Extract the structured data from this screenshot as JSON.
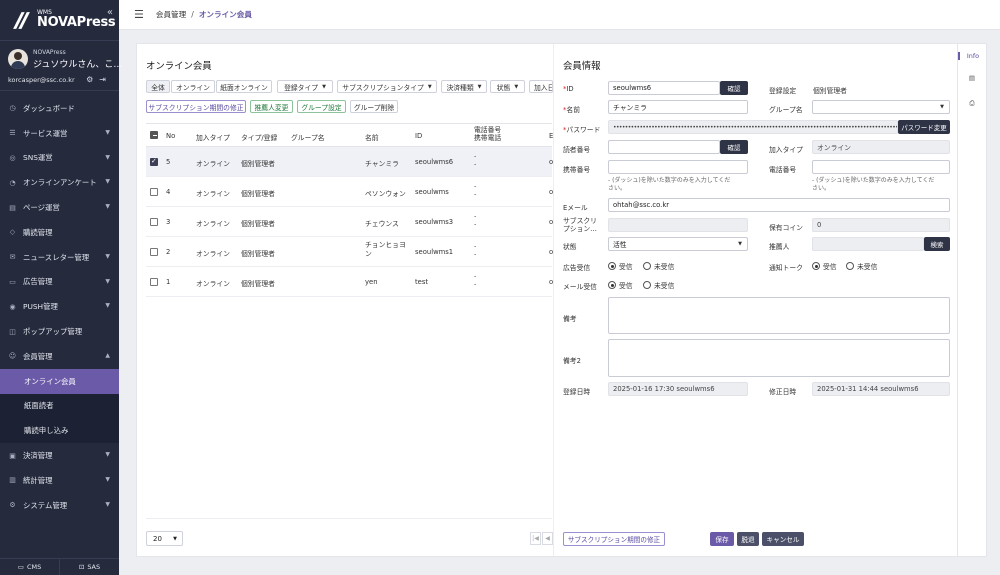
{
  "brand": {
    "wms": "WMS",
    "name": "NOVAPress"
  },
  "user": {
    "org": "NOVAPress",
    "name": "ジュソウルさん、こ…",
    "email": "korcasper@ssc.co.kr"
  },
  "menu": [
    {
      "label": "ダッシュボード",
      "icon": "dashboard-icon"
    },
    {
      "label": "サービス運営",
      "icon": "service-icon",
      "chev": "▼"
    },
    {
      "label": "SNS運営",
      "icon": "sns-icon",
      "chev": "▼"
    },
    {
      "label": "オンラインアンケート",
      "icon": "survey-icon",
      "chev": "▼"
    },
    {
      "label": "ページ運営",
      "icon": "page-icon",
      "chev": "▼"
    },
    {
      "label": "購読管理",
      "icon": "tag-icon"
    },
    {
      "label": "ニュースレター管理",
      "icon": "newsletter-icon",
      "chev": "▼"
    },
    {
      "label": "広告管理",
      "icon": "ad-icon",
      "chev": "▼"
    },
    {
      "label": "PUSH管理",
      "icon": "push-icon",
      "chev": "▼"
    },
    {
      "label": "ポップアップ管理",
      "icon": "popup-icon"
    },
    {
      "label": "会員管理",
      "icon": "member-icon",
      "chev": "▲"
    },
    {
      "label": "オンライン会員",
      "sub": true,
      "active": true
    },
    {
      "label": "紙面読者",
      "sub": true
    },
    {
      "label": "購読申し込み",
      "sub": true
    },
    {
      "label": "決済管理",
      "icon": "payment-icon",
      "chev": "▼"
    },
    {
      "label": "統計管理",
      "icon": "stats-icon",
      "chev": "▼"
    },
    {
      "label": "システム管理",
      "icon": "system-icon",
      "chev": "▼"
    }
  ],
  "footer": {
    "cms": "CMS",
    "sas": "SAS"
  },
  "breadcrumb": {
    "parent": "会員管理",
    "sep": "/",
    "current": "オンライン会員"
  },
  "list": {
    "title": "オンライン会員",
    "filters": {
      "all": "全体",
      "online": "オンライン",
      "paper_online": "紙面オンライン",
      "reg_type": "登録タイプ",
      "sub_type": "サブスクリプションタイプ",
      "payment": "決済種類",
      "status": "状態",
      "join_date": "加入日"
    },
    "actions": {
      "fix_sub": "サブスクリプション期間の修正",
      "change_recommender": "推薦人変更",
      "group_set": "グループ設定",
      "group_delete": "グループ削除"
    },
    "columns": {
      "no": "No",
      "join_type": "加入タイプ",
      "type_reg": "タイプ/登録",
      "group": "グループ名",
      "name": "名前",
      "id": "ID",
      "phone1": "電話番号",
      "phone2": "携帯電話",
      "extra": "E"
    },
    "rows": [
      {
        "no": "5",
        "join": "オンライン",
        "type": "個別管理者",
        "group": "",
        "name": "チャンミラ",
        "name2": "",
        "id": "seoulwms6",
        "p1": "-",
        "p2": "-",
        "e": "o",
        "checked": true
      },
      {
        "no": "4",
        "join": "オンライン",
        "type": "個別管理者",
        "group": "",
        "name": "ペソンウォン",
        "name2": "",
        "id": "seoulwms",
        "p1": "-",
        "p2": "-",
        "e": "o",
        "checked": false
      },
      {
        "no": "3",
        "join": "オンライン",
        "type": "個別管理者",
        "group": "",
        "name": "チェウンス",
        "name2": "",
        "id": "seoulwms3",
        "p1": "-",
        "p2": "-",
        "e": "o",
        "checked": false
      },
      {
        "no": "2",
        "join": "オンライン",
        "type": "個別管理者",
        "group": "",
        "name": "チョンヒョヨ",
        "name2": "ン",
        "id": "seoulwms1",
        "p1": "-",
        "p2": "-",
        "e": "o",
        "checked": false
      },
      {
        "no": "1",
        "join": "オンライン",
        "type": "個別管理者",
        "group": "",
        "name": "yen",
        "name2": "",
        "id": "test",
        "p1": "-",
        "p2": "-",
        "e": "o",
        "checked": false
      }
    ],
    "page_size": "20",
    "pager": {
      "first": "|◀",
      "prev": "◀"
    }
  },
  "detail": {
    "title": "会員情報",
    "required_mark": "*",
    "labels": {
      "id": "ID",
      "reg_setting": "登録設定",
      "name": "名前",
      "group": "グループ名",
      "password": "パスワード",
      "reader_no": "読者番号",
      "join_type": "加入タイプ",
      "mobile": "携帯番号",
      "phone": "電話番号",
      "email": "Eメール",
      "subscription": "サブスクリ",
      "subscription2": "プション…",
      "coin": "保有コイン",
      "status": "状態",
      "recommender": "推薦人",
      "ad_recv": "広告受信",
      "notify": "通知トーク",
      "mail_recv": "メール受信",
      "note": "備考",
      "note2": "備考2",
      "created": "登録日時",
      "modified": "修正日時"
    },
    "values": {
      "id": "seoulwms6",
      "reg_setting": "個別管理者",
      "name": "チャンミラ",
      "group": "",
      "password": "••••••••••••••••••••••••••••••••••••••••••••••••••••••••••••••••••••••••••••••••••••••••••••••••••••••••••••••••••",
      "reader_no": "",
      "join_type": "オンライン",
      "mobile": "",
      "phone": "",
      "email": "ohtah@ssc.co.kr",
      "subscription": "",
      "coin": "0",
      "status": "活性",
      "recommender": "",
      "created": "2025-01-16 17:30 seoulwms6",
      "modified": "2025-01-31 14:44 seoulwms6"
    },
    "hint": "- (ダッシュ)を除いた数字のみを入力してくだ",
    "hint2": "さい。",
    "buttons": {
      "confirm": "確認",
      "confirm2": "確認",
      "change_pw": "パスワード変更",
      "search": "検索",
      "fix_sub": "サブスクリプション期間の修正",
      "save": "保存",
      "withdraw": "脱退",
      "cancel": "キャンセル"
    },
    "radio": {
      "on": "受信",
      "off": "未受信"
    }
  },
  "side_tabs": {
    "info": "Info"
  }
}
